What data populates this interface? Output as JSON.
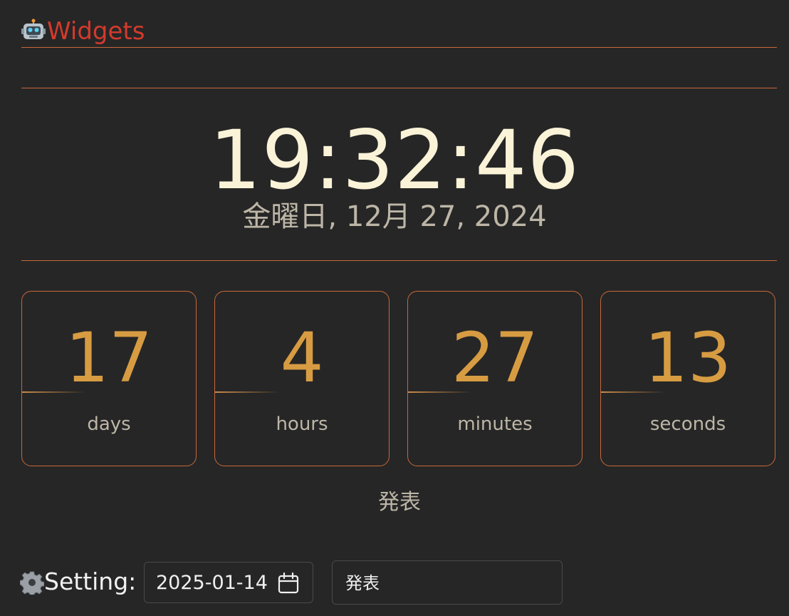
{
  "header": {
    "title": "Widgets",
    "icon": "robot-icon"
  },
  "clock": {
    "time": "19:32:46",
    "date": "金曜日, 12月 27, 2024"
  },
  "countdown": {
    "units": [
      {
        "value": "17",
        "label": "days"
      },
      {
        "value": "4",
        "label": "hours"
      },
      {
        "value": "27",
        "label": "minutes"
      },
      {
        "value": "13",
        "label": "seconds"
      }
    ],
    "event_title": "発表"
  },
  "settings": {
    "label": "Setting:",
    "icon": "gear-icon",
    "target_date": "2025-01-14",
    "event_name": "発表"
  },
  "colors": {
    "background": "#262626",
    "accent_line": "#c8683a",
    "title": "#d33a2c",
    "clock": "#faf3d8",
    "countdown_value": "#d79c42",
    "muted_text": "#bdb6a7"
  }
}
